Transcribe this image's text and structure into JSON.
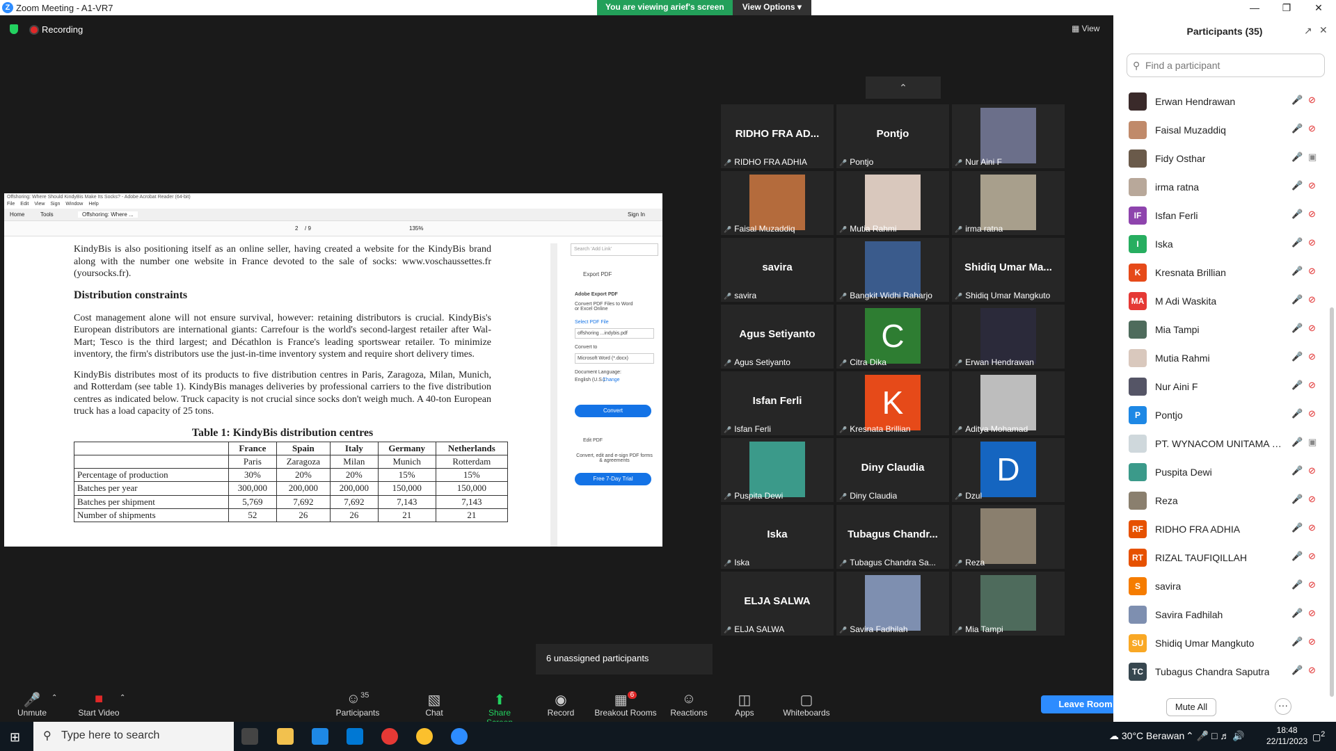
{
  "window": {
    "title": "Zoom Meeting - A1-VR7"
  },
  "banner": {
    "message": "You are viewing arief's screen",
    "options": "View Options"
  },
  "recording": "Recording",
  "view_label": "View",
  "pdf": {
    "title": "Offshoring: Where Should KindyBis Make Its Socks? - Adobe Acrobat Reader (64-bit)",
    "menu": [
      "File",
      "Edit",
      "View",
      "Sign",
      "Window",
      "Help"
    ],
    "tabs": {
      "home": "Home",
      "tools": "Tools",
      "doc": "Offshoring: Where ...",
      "sign_in": "Sign In"
    },
    "page_num": "2",
    "page_total": "/ 9",
    "zoom": "135%",
    "para0": "KindyBis is also positioning itself as an online seller, having created a website for the KindyBis brand along with the number one website in France devoted to the sale of socks: www.voschaussettes.fr (yoursocks.fr).",
    "heading": "Distribution constraints",
    "para1": "Cost management alone will not ensure survival, however: retaining distributors is crucial. KindyBis's European distributors are international giants: Carrefour is the world's second-largest retailer after Wal-Mart; Tesco is the third largest; and Décathlon is France's leading sportswear retailer. To minimize inventory, the firm's distributors use the just-in-time inventory system and require short delivery times.",
    "para2": "KindyBis distributes most of its products to five distribution centres in Paris, Zaragoza, Milan, Munich, and Rotterdam (see table 1). KindyBis manages deliveries by professional carriers to the five distribution centres as indicated below. Truck capacity is not crucial since socks don't weigh much. A 40-ton European truck has a load capacity of 25 tons.",
    "table_title": "Table 1: KindyBis distribution centres",
    "table": {
      "countries": [
        "France",
        "Spain",
        "Italy",
        "Germany",
        "Netherlands"
      ],
      "cities": [
        "Paris",
        "Zaragoza",
        "Milan",
        "Munich",
        "Rotterdam"
      ],
      "rows": [
        {
          "label": "Percentage of production",
          "vals": [
            "30%",
            "20%",
            "20%",
            "15%",
            "15%"
          ]
        },
        {
          "label": "Batches per year",
          "vals": [
            "300,000",
            "200,000",
            "200,000",
            "150,000",
            "150,000"
          ]
        },
        {
          "label": "Batches per shipment",
          "vals": [
            "5,769",
            "7,692",
            "7,692",
            "7,143",
            "7,143"
          ]
        },
        {
          "label": "Number of shipments",
          "vals": [
            "52",
            "26",
            "26",
            "21",
            "21"
          ]
        }
      ]
    },
    "side": {
      "search": "Search 'Add Link'",
      "export": "Export PDF",
      "export_title": "Adobe Export PDF",
      "export_desc": "Convert PDF Files to Word or Excel Online",
      "select": "Select PDF File",
      "file": "offshoring ...indybis.pdf",
      "convert_to": "Convert to",
      "format": "Microsoft Word (*.docx)",
      "lang_label": "Document Language:",
      "lang": "English (U.S.)",
      "change": "Change",
      "convert": "Convert",
      "edit": "Edit PDF",
      "promo": "Convert, edit and e-sign PDF forms & agreements",
      "trial": "Free 7-Day Trial"
    }
  },
  "tiles": [
    {
      "name": "RIDHO FRA AD...",
      "label": "RIDHO FRA ADHIA",
      "type": "name"
    },
    {
      "name": "Pontjo",
      "label": "Pontjo",
      "type": "name"
    },
    {
      "name": "",
      "label": "Nur Aini F",
      "type": "photo",
      "color": "#6b6f8a"
    },
    {
      "name": "",
      "label": "Faisal Muzaddiq",
      "type": "photo",
      "color": "#b46b3c"
    },
    {
      "name": "",
      "label": "Mutia Rahmi",
      "type": "photo",
      "color": "#d9c8bd"
    },
    {
      "name": "",
      "label": "irma ratna",
      "type": "photo",
      "color": "#a89f8c"
    },
    {
      "name": "savira",
      "label": "savira",
      "type": "name"
    },
    {
      "name": "",
      "label": "Bangkit Widhi Raharjo",
      "type": "photo",
      "color": "#3a5b8c"
    },
    {
      "name": "Shidiq Umar Ma...",
      "label": "Shidiq Umar Mangkuto",
      "type": "name"
    },
    {
      "name": "Agus Setiyanto",
      "label": "Agus Setiyanto",
      "type": "name"
    },
    {
      "name": "C",
      "label": "Citra Dika",
      "type": "letter",
      "color": "#2e7d32"
    },
    {
      "name": "",
      "label": "Erwan Hendrawan",
      "type": "photo",
      "color": "#2b2a3a"
    },
    {
      "name": "Isfan Ferli",
      "label": "Isfan Ferli",
      "type": "name"
    },
    {
      "name": "K",
      "label": "Kresnata Brillian",
      "type": "letter",
      "color": "#e64a19"
    },
    {
      "name": "",
      "label": "Aditya Mohamad",
      "type": "photo",
      "color": "#bdbdbd"
    },
    {
      "name": "",
      "label": "Puspita Dewi",
      "type": "photo",
      "color": "#3b9a8a"
    },
    {
      "name": "Diny Claudia",
      "label": "Diny Claudia",
      "type": "name"
    },
    {
      "name": "D",
      "label": "Dzul",
      "type": "letter",
      "color": "#1565c0"
    },
    {
      "name": "Iska",
      "label": "Iska",
      "type": "name"
    },
    {
      "name": "Tubagus Chandr...",
      "label": "Tubagus Chandra Sa...",
      "type": "name"
    },
    {
      "name": "",
      "label": "Reza",
      "type": "photo",
      "color": "#8a7f6e"
    },
    {
      "name": "ELJA SALWA",
      "label": "ELJA SALWA",
      "type": "name"
    },
    {
      "name": "",
      "label": "Savira Fadhilah",
      "type": "photo",
      "color": "#7e8fb0"
    },
    {
      "name": "",
      "label": "Mia Tampi",
      "type": "photo",
      "color": "#4e6b5c"
    }
  ],
  "unassigned": "6 unassigned participants",
  "toolbar": {
    "unmute": "Unmute",
    "start_video": "Start Video",
    "participants": "Participants",
    "participants_count": "35",
    "chat": "Chat",
    "share": "Share Screen",
    "record": "Record",
    "breakout": "Breakout Rooms",
    "breakout_badge": "6",
    "reactions": "Reactions",
    "apps": "Apps",
    "whiteboards": "Whiteboards",
    "leave": "Leave Room"
  },
  "panel": {
    "header": "Participants (35)",
    "search_placeholder": "Find a participant",
    "mute_all": "Mute All",
    "more": "···",
    "list": [
      {
        "name": "Erwan Hendrawan",
        "initials": "",
        "color": "#3a2a2a",
        "cam": "off"
      },
      {
        "name": "Faisal Muzaddiq",
        "initials": "",
        "color": "#c08a6a",
        "cam": "off"
      },
      {
        "name": "Fidy Osthar",
        "initials": "",
        "color": "#6a5a4a",
        "cam": "on"
      },
      {
        "name": "irma ratna",
        "initials": "",
        "color": "#b8a89a",
        "cam": "off"
      },
      {
        "name": "Isfan Ferli",
        "initials": "IF",
        "color": "#8e44ad",
        "cam": "off"
      },
      {
        "name": "Iska",
        "initials": "I",
        "color": "#27ae60",
        "cam": "off"
      },
      {
        "name": "Kresnata Brillian",
        "initials": "K",
        "color": "#e64a19",
        "cam": "off"
      },
      {
        "name": "M Adi Waskita",
        "initials": "MA",
        "color": "#e53935",
        "cam": "off"
      },
      {
        "name": "Mia Tampi",
        "initials": "",
        "color": "#4e6b5c",
        "cam": "off"
      },
      {
        "name": "Mutia Rahmi",
        "initials": "",
        "color": "#d9c8bd",
        "cam": "off"
      },
      {
        "name": "Nur Aini F",
        "initials": "",
        "color": "#555566",
        "cam": "off"
      },
      {
        "name": "Pontjo",
        "initials": "P",
        "color": "#1e88e5",
        "cam": "off"
      },
      {
        "name": "PT. WYNACOM UNITAMA SEJA...",
        "initials": "",
        "color": "#cfd8dc",
        "cam": "on"
      },
      {
        "name": "Puspita Dewi",
        "initials": "",
        "color": "#3b9a8a",
        "cam": "off"
      },
      {
        "name": "Reza",
        "initials": "",
        "color": "#8a7f6e",
        "cam": "off"
      },
      {
        "name": "RIDHO FRA ADHIA",
        "initials": "RF",
        "color": "#e65100",
        "cam": "off"
      },
      {
        "name": "RIZAL TAUFIQILLAH",
        "initials": "RT",
        "color": "#e65100",
        "cam": "off"
      },
      {
        "name": "savira",
        "initials": "S",
        "color": "#f57c00",
        "cam": "off"
      },
      {
        "name": "Savira Fadhilah",
        "initials": "",
        "color": "#7e8fb0",
        "cam": "off"
      },
      {
        "name": "Shidiq Umar Mangkuto",
        "initials": "SU",
        "color": "#f9a825",
        "cam": "off"
      },
      {
        "name": "Tubagus Chandra Saputra",
        "initials": "TC",
        "color": "#37474f",
        "cam": "off"
      }
    ]
  },
  "taskbar": {
    "search": "Type here to search",
    "weather": "30°C Berawan",
    "time": "18:48",
    "date": "22/11/2023",
    "notif": "2"
  }
}
